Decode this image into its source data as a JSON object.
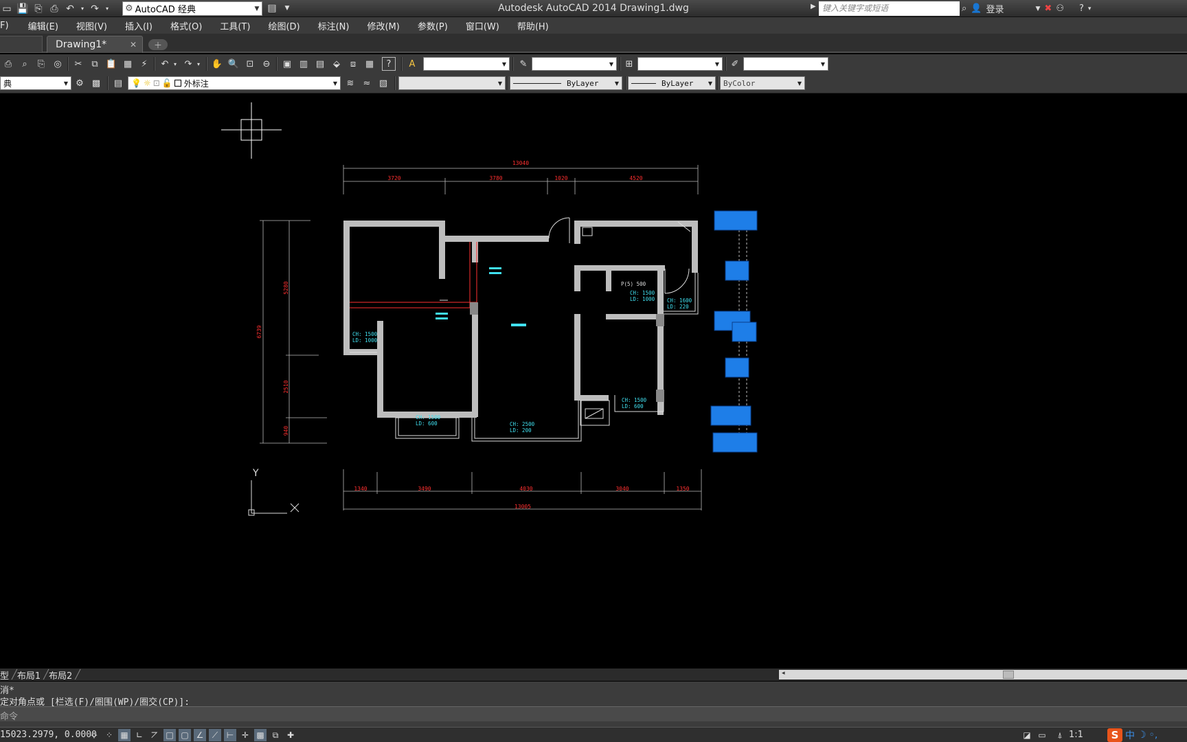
{
  "window": {
    "title": "Autodesk AutoCAD 2014    Drawing1.dwg"
  },
  "workspace": {
    "value": "AutoCAD 经典"
  },
  "search": {
    "placeholder": "键入关键字或短语"
  },
  "account": {
    "login_label": "登录"
  },
  "menu": [
    "F)",
    "编辑(E)",
    "视图(V)",
    "插入(I)",
    "格式(O)",
    "工具(T)",
    "绘图(D)",
    "标注(N)",
    "修改(M)",
    "参数(P)",
    "窗口(W)",
    "帮助(H)"
  ],
  "tabs": {
    "document": "Drawing1*"
  },
  "toolbar": {
    "style_left": "典",
    "layer": "外标注",
    "linetype": "ByLayer",
    "lineweight": "ByLayer",
    "color": "ByColor"
  },
  "drawing": {
    "top_total": "13040",
    "top_dims": [
      "3720",
      "3780",
      "1020",
      "4520"
    ],
    "left_total": "6739",
    "left_dims": [
      "5280",
      "2510",
      "940"
    ],
    "bottom_dims": [
      "1340",
      "3490",
      "4030",
      "3040",
      "1350"
    ],
    "bottom_total": "13005",
    "room_labels": [
      {
        "ch": "CH: 1500",
        "ld": "LD: 1000"
      },
      {
        "ch": "CH: 1500",
        "ld": "LD: 600"
      },
      {
        "ch": "CH: 2500",
        "ld": "LD: 200"
      },
      {
        "ch": "CH: 1500",
        "ld": "LD: 600"
      },
      {
        "ch": "CH: 1500",
        "ld": "LD: 1000"
      },
      {
        "ch": "CH: 1600",
        "ld": "LD: 220"
      }
    ],
    "small_note": "P(5)  500",
    "ucs_y": "Y",
    "ucs_x": "X"
  },
  "layout_tabs": [
    "型",
    "布局1",
    "布局2"
  ],
  "command": {
    "line1": "消*",
    "line2": "定对角点或 [栏选(F)/圈围(WP)/圈交(CP)]:",
    "prompt": "命令"
  },
  "status": {
    "coords": "15023.2979, 0.0000",
    "scale": "1:1"
  },
  "colors": {
    "dim_red": "#ff3030",
    "text_cyan": "#40e0f0",
    "block_blue": "#1e7ee8",
    "wall": "#bdbdbd"
  }
}
